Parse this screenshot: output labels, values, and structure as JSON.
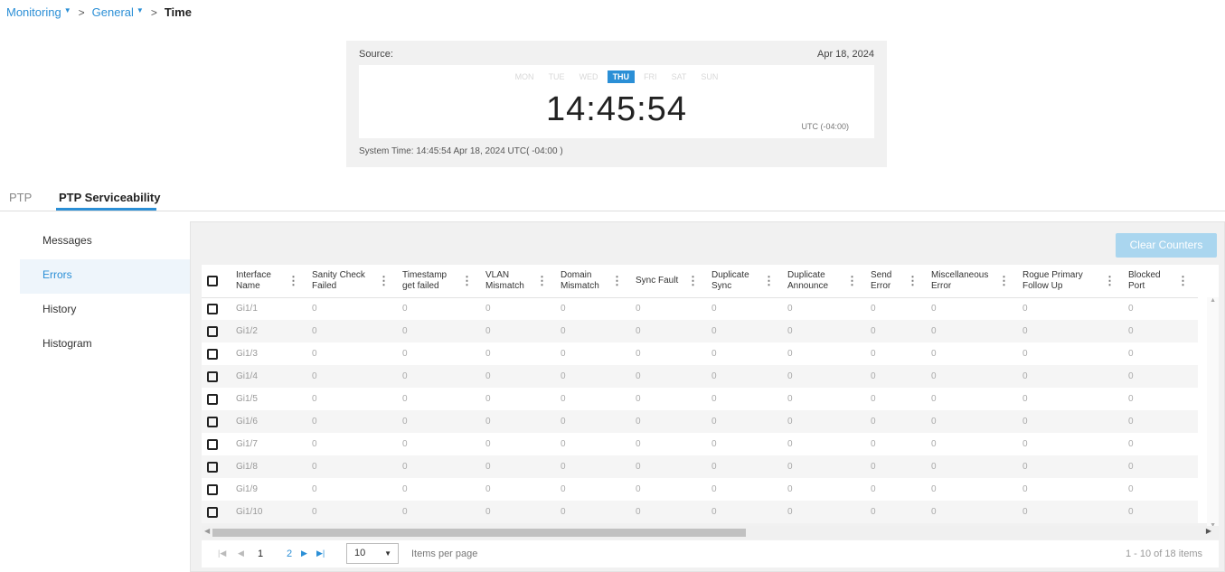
{
  "breadcrumb": {
    "items": [
      {
        "label": "Monitoring"
      },
      {
        "label": "General"
      }
    ],
    "current": "Time"
  },
  "time_panel": {
    "source_label": "Source:",
    "date": "Apr 18, 2024",
    "days": [
      "MON",
      "TUE",
      "WED",
      "THU",
      "FRI",
      "SAT",
      "SUN"
    ],
    "active_day": "THU",
    "clock": "14:45:54",
    "utc": "UTC (-04:00)",
    "system_time": "System Time: 14:45:54 Apr 18, 2024 UTC( -04:00 )"
  },
  "tabs": [
    {
      "label": "PTP"
    },
    {
      "label": "PTP Serviceability",
      "active": true
    }
  ],
  "sidenav": [
    {
      "label": "Messages"
    },
    {
      "label": "Errors",
      "active": true
    },
    {
      "label": "History"
    },
    {
      "label": "Histogram"
    }
  ],
  "toolbar": {
    "clear_label": "Clear Counters"
  },
  "table": {
    "columns": [
      [
        "Interface",
        "Name"
      ],
      [
        "Sanity Check",
        "Failed"
      ],
      [
        "Timestamp",
        "get failed"
      ],
      [
        "VLAN",
        "Mismatch"
      ],
      [
        "Domain",
        "Mismatch"
      ],
      [
        "Sync Fault",
        ""
      ],
      [
        "Duplicate",
        "Sync"
      ],
      [
        "Duplicate",
        "Announce"
      ],
      [
        "Send",
        "Error"
      ],
      [
        "Miscellaneous",
        "Error"
      ],
      [
        "Rogue Primary",
        "Follow Up"
      ],
      [
        "Blocked",
        "Port"
      ]
    ],
    "rows": [
      [
        "Gi1/1",
        "0",
        "0",
        "0",
        "0",
        "0",
        "0",
        "0",
        "0",
        "0",
        "0",
        "0"
      ],
      [
        "Gi1/2",
        "0",
        "0",
        "0",
        "0",
        "0",
        "0",
        "0",
        "0",
        "0",
        "0",
        "0"
      ],
      [
        "Gi1/3",
        "0",
        "0",
        "0",
        "0",
        "0",
        "0",
        "0",
        "0",
        "0",
        "0",
        "0"
      ],
      [
        "Gi1/4",
        "0",
        "0",
        "0",
        "0",
        "0",
        "0",
        "0",
        "0",
        "0",
        "0",
        "0"
      ],
      [
        "Gi1/5",
        "0",
        "0",
        "0",
        "0",
        "0",
        "0",
        "0",
        "0",
        "0",
        "0",
        "0"
      ],
      [
        "Gi1/6",
        "0",
        "0",
        "0",
        "0",
        "0",
        "0",
        "0",
        "0",
        "0",
        "0",
        "0"
      ],
      [
        "Gi1/7",
        "0",
        "0",
        "0",
        "0",
        "0",
        "0",
        "0",
        "0",
        "0",
        "0",
        "0"
      ],
      [
        "Gi1/8",
        "0",
        "0",
        "0",
        "0",
        "0",
        "0",
        "0",
        "0",
        "0",
        "0",
        "0"
      ],
      [
        "Gi1/9",
        "0",
        "0",
        "0",
        "0",
        "0",
        "0",
        "0",
        "0",
        "0",
        "0",
        "0"
      ],
      [
        "Gi1/10",
        "0",
        "0",
        "0",
        "0",
        "0",
        "0",
        "0",
        "0",
        "0",
        "0",
        "0"
      ]
    ]
  },
  "pager": {
    "page1": "1",
    "page2": "2",
    "per_page": "10",
    "per_page_label": "Items per page",
    "range": "1 - 10 of 18 items"
  },
  "colors": {
    "accent": "#2b8fd6",
    "button_disabled": "#aad6ef"
  }
}
